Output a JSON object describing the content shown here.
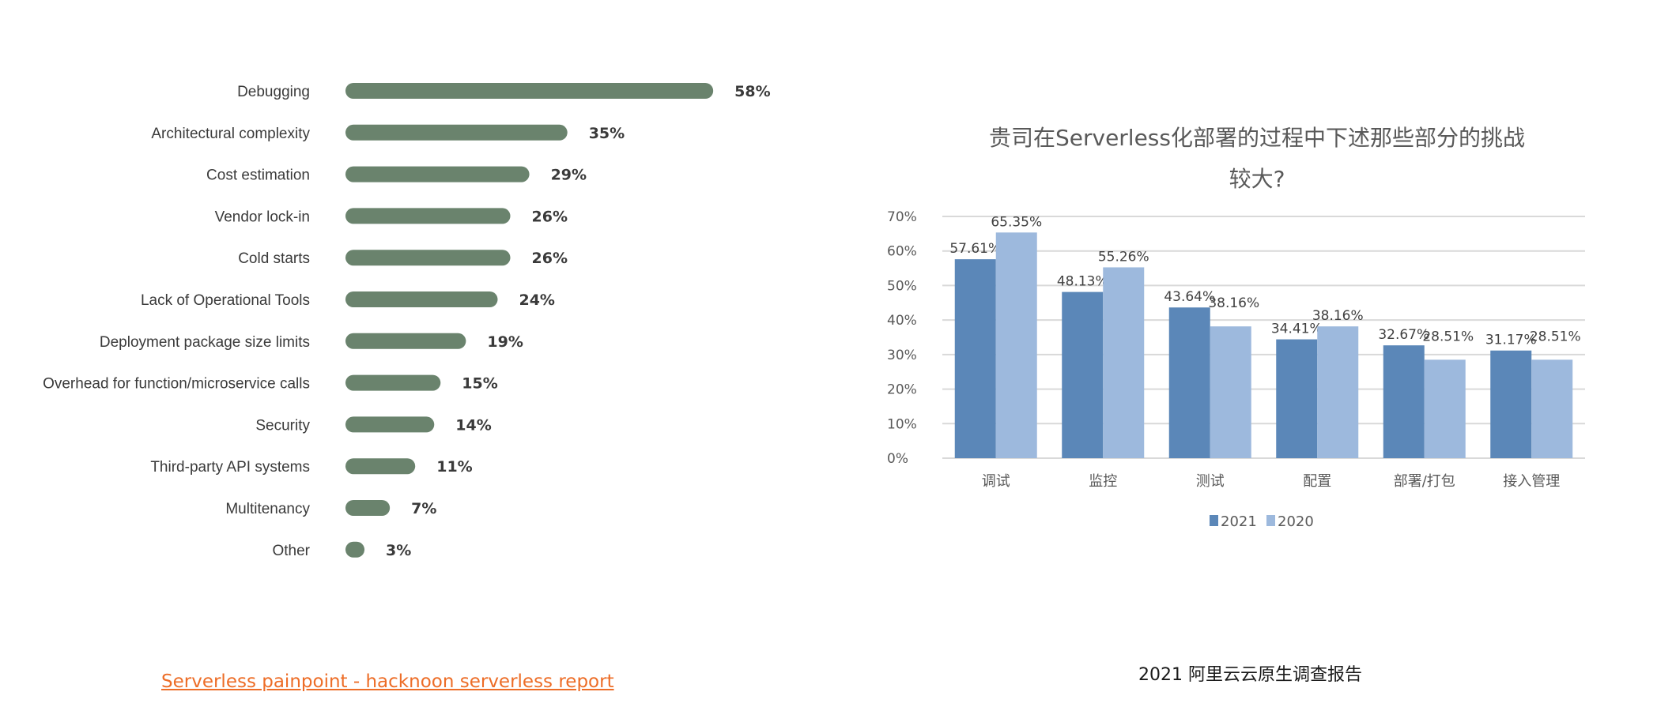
{
  "chart_data": [
    {
      "type": "bar",
      "orientation": "horizontal",
      "title": "",
      "xlabel": "",
      "ylabel": "",
      "categories": [
        "Debugging",
        "Architectural complexity",
        "Cost estimation",
        "Vendor lock-in",
        "Cold starts",
        "Lack of Operational Tools",
        "Deployment package size limits",
        "Overhead for function/microservice calls",
        "Security",
        "Third-party API systems",
        "Multitenancy",
        "Other"
      ],
      "values": [
        58,
        35,
        29,
        26,
        26,
        24,
        19,
        15,
        14,
        11,
        7,
        3
      ],
      "value_labels": [
        "58%",
        "35%",
        "29%",
        "26%",
        "26%",
        "24%",
        "19%",
        "15%",
        "14%",
        "11%",
        "7%",
        "3%"
      ],
      "unit": "%",
      "bar_color": "#6a836d",
      "grid": false,
      "legend": "none"
    },
    {
      "type": "bar",
      "orientation": "vertical",
      "title_lines": [
        "贵司在Serverless化部署的过程中下述那些部分的挑战",
        "较大?"
      ],
      "xlabel": "",
      "ylabel": "",
      "categories": [
        "调试",
        "监控",
        "测试",
        "配置",
        "部署/打包",
        "接入管理"
      ],
      "series": [
        {
          "name": "2021",
          "color": "#5b87b8",
          "values": [
            57.61,
            48.13,
            43.64,
            34.41,
            32.67,
            31.17
          ],
          "labels": [
            "57.61%",
            "48.13%",
            "43.64%",
            "34.41%",
            "32.67%",
            "31.17%"
          ]
        },
        {
          "name": "2020",
          "color": "#9db9dd",
          "values": [
            65.35,
            55.26,
            38.16,
            38.16,
            28.51,
            28.51
          ],
          "labels": [
            "65.35%",
            "55.26%",
            "38.16%",
            "38.16%",
            "28.51%",
            "28.51%"
          ]
        }
      ],
      "ylim": [
        0,
        70
      ],
      "yticks": [
        0,
        10,
        20,
        30,
        40,
        50,
        60,
        70
      ],
      "ytick_labels": [
        "0%",
        "10%",
        "20%",
        "30%",
        "40%",
        "50%",
        "60%",
        "70%"
      ],
      "grid": true,
      "grid_color": "#d9d9d9",
      "legend": "bottom-center"
    }
  ],
  "captions": {
    "left_source_link": "Serverless painpoint - hacknoon serverless report",
    "right_caption": "2021 阿里云云原生调查报告"
  }
}
